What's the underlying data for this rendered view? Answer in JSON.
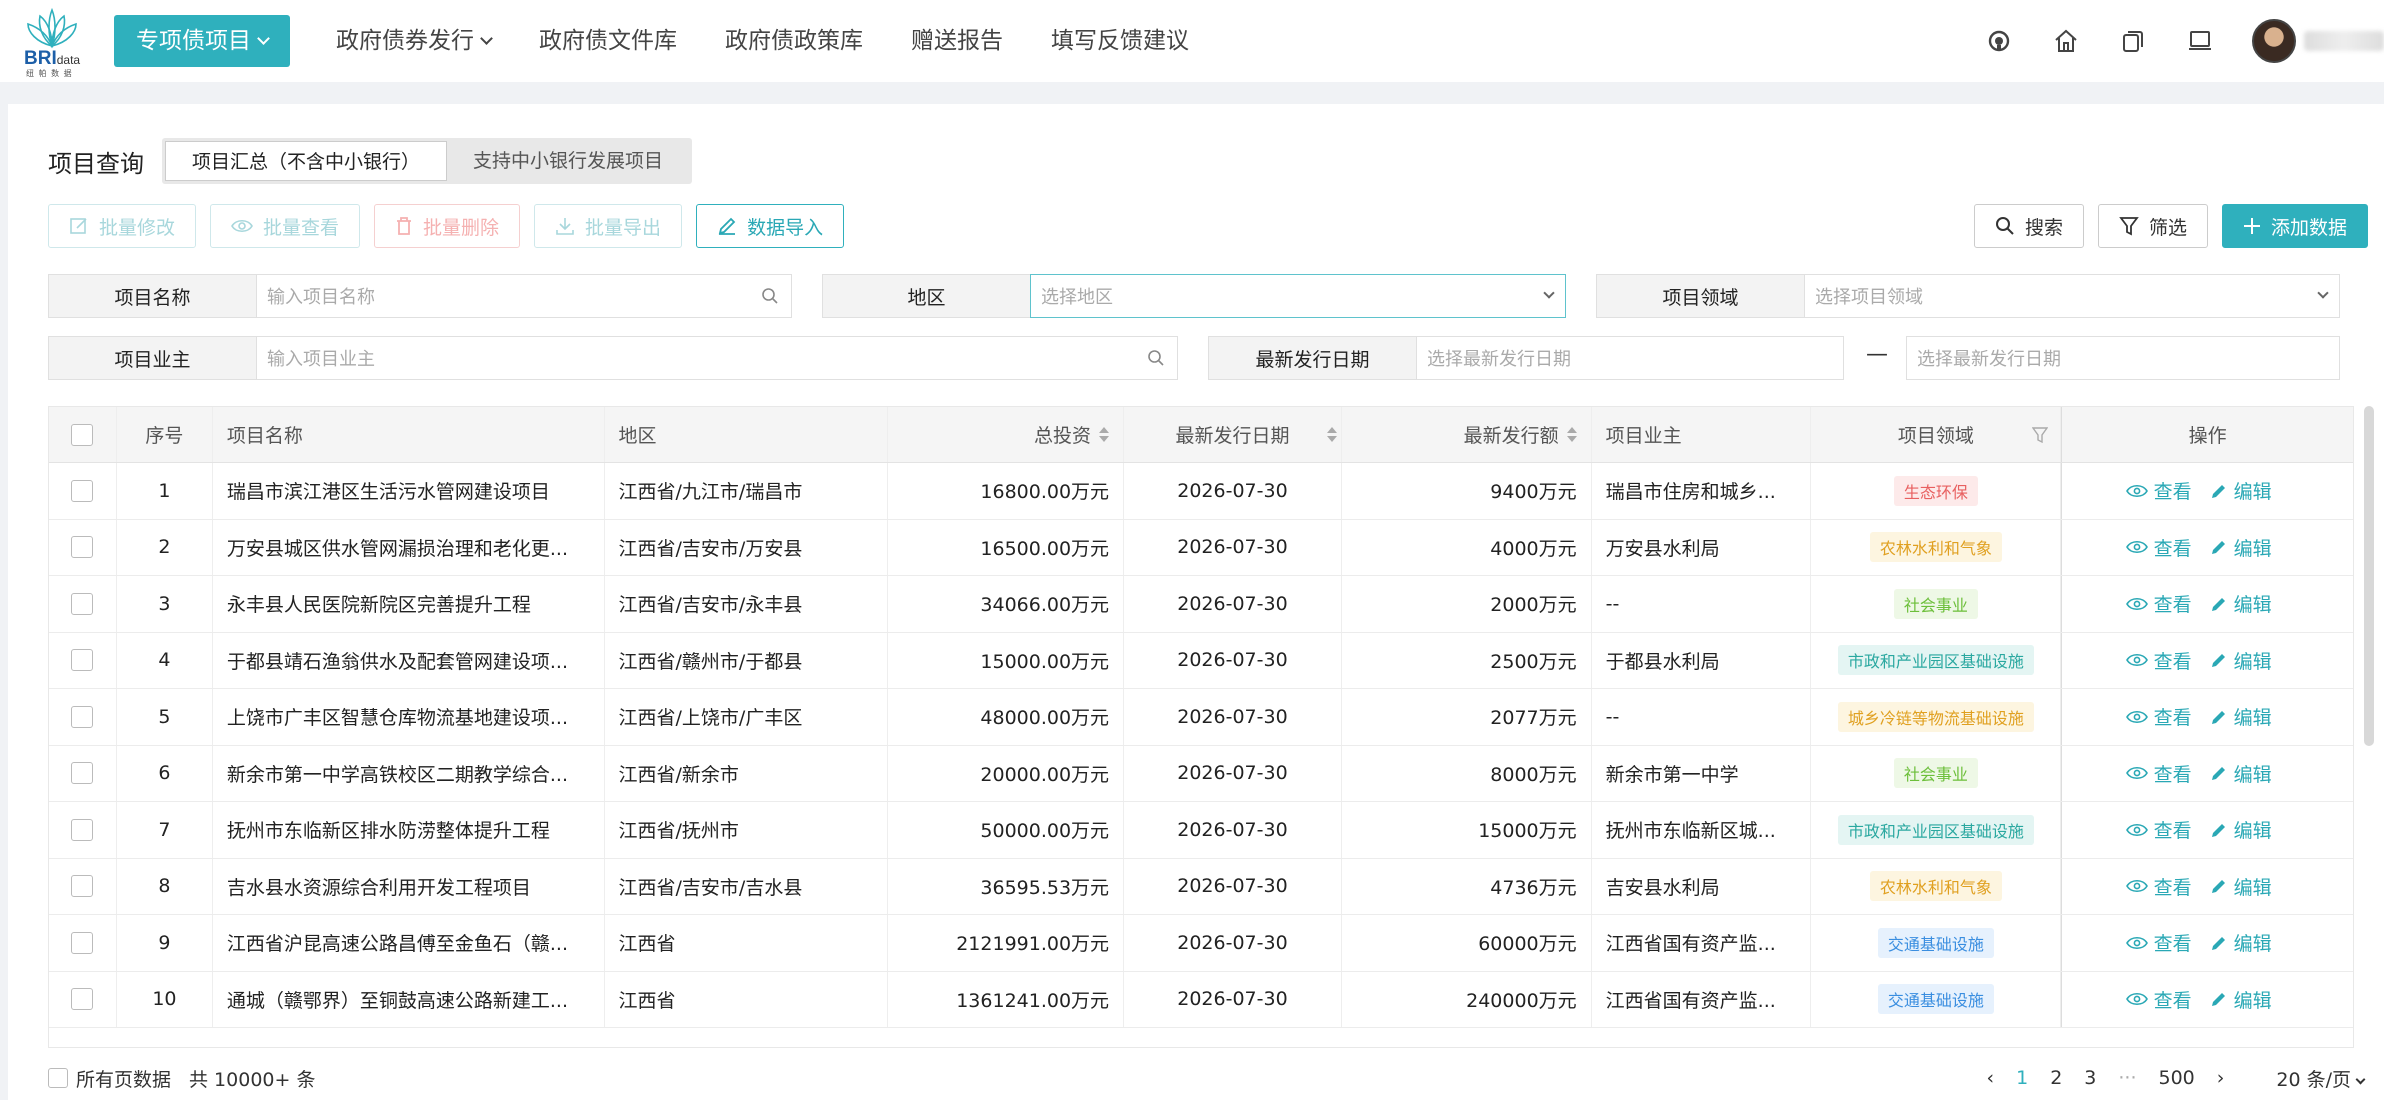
{
  "logo": {
    "brand": "BRI",
    "brand_small": "data",
    "sub": "纽 帕 数 据"
  },
  "nav": {
    "items": [
      {
        "label": "专项债项目",
        "active": true,
        "dropdown": true
      },
      {
        "label": "政府债券发行",
        "active": false,
        "dropdown": true
      },
      {
        "label": "政府债文件库",
        "active": false,
        "dropdown": false
      },
      {
        "label": "政府债政策库",
        "active": false,
        "dropdown": false
      },
      {
        "label": "赠送报告",
        "active": false,
        "dropdown": false
      },
      {
        "label": "填写反馈建议",
        "active": false,
        "dropdown": false
      }
    ],
    "right_icons": [
      "headset-icon",
      "home-icon",
      "copy-icon",
      "monitor-icon"
    ]
  },
  "page": {
    "title": "项目查询",
    "tabs": [
      {
        "label": "项目汇总（不含中小银行）",
        "active": true
      },
      {
        "label": "支持中小银行发展项目",
        "active": false
      }
    ]
  },
  "toolbar": {
    "batch_edit": "批量修改",
    "batch_view": "批量查看",
    "batch_delete": "批量删除",
    "batch_export": "批量导出",
    "data_import": "数据导入",
    "search": "搜索",
    "filter": "筛选",
    "add": "添加数据"
  },
  "filters": {
    "name": {
      "label": "项目名称",
      "placeholder": "输入项目名称"
    },
    "area": {
      "label": "地区",
      "placeholder": "选择地区"
    },
    "field": {
      "label": "项目领域",
      "placeholder": "选择项目领域"
    },
    "owner": {
      "label": "项目业主",
      "placeholder": "输入项目业主"
    },
    "date": {
      "label": "最新发行日期",
      "placeholder_start": "选择最新发行日期",
      "placeholder_end": "选择最新发行日期",
      "separator": "—"
    }
  },
  "table": {
    "headers": {
      "no": "序号",
      "name": "项目名称",
      "area": "地区",
      "investment": "总投资",
      "date": "最新发行日期",
      "amount": "最新发行额",
      "owner": "项目业主",
      "field": "项目领域",
      "op": "操作"
    },
    "view_label": "查看",
    "edit_label": "编辑",
    "rows": [
      {
        "no": "1",
        "name": "瑞昌市滨江港区生活污水管网建设项目",
        "area": "江西省/九江市/瑞昌市",
        "investment": "16800.00万元",
        "date": "2026-07-30",
        "amount": "9400万元",
        "owner": "瑞昌市住房和城乡...",
        "field": "生态环保",
        "field_color": "#e86060",
        "field_bg": "#fdeaea"
      },
      {
        "no": "2",
        "name": "万安县城区供水管网漏损治理和老化更...",
        "area": "江西省/吉安市/万安县",
        "investment": "16500.00万元",
        "date": "2026-07-30",
        "amount": "4000万元",
        "owner": "万安县水利局",
        "field": "农林水利和气象",
        "field_color": "#e0a020",
        "field_bg": "#fdf5e0"
      },
      {
        "no": "3",
        "name": "永丰县人民医院新院区完善提升工程",
        "area": "江西省/吉安市/永丰县",
        "investment": "34066.00万元",
        "date": "2026-07-30",
        "amount": "2000万元",
        "owner": "--",
        "field": "社会事业",
        "field_color": "#6cbf3a",
        "field_bg": "#eef8e6"
      },
      {
        "no": "4",
        "name": "于都县靖石渔翁供水及配套管网建设项...",
        "area": "江西省/赣州市/于都县",
        "investment": "15000.00万元",
        "date": "2026-07-30",
        "amount": "2500万元",
        "owner": "于都县水利局",
        "field": "市政和产业园区基础设施",
        "field_color": "#2aa8a0",
        "field_bg": "#e4f5f3"
      },
      {
        "no": "5",
        "name": "上饶市广丰区智慧仓库物流基地建设项...",
        "area": "江西省/上饶市/广丰区",
        "investment": "48000.00万元",
        "date": "2026-07-30",
        "amount": "2077万元",
        "owner": "--",
        "field": "城乡冷链等物流基础设施",
        "field_color": "#e0a020",
        "field_bg": "#fdf5e0"
      },
      {
        "no": "6",
        "name": "新余市第一中学高铁校区二期教学综合...",
        "area": "江西省/新余市",
        "investment": "20000.00万元",
        "date": "2026-07-30",
        "amount": "8000万元",
        "owner": "新余市第一中学",
        "field": "社会事业",
        "field_color": "#6cbf3a",
        "field_bg": "#eef8e6"
      },
      {
        "no": "7",
        "name": "抚州市东临新区排水防涝整体提升工程",
        "area": "江西省/抚州市",
        "investment": "50000.00万元",
        "date": "2026-07-30",
        "amount": "15000万元",
        "owner": "抚州市东临新区城...",
        "field": "市政和产业园区基础设施",
        "field_color": "#2aa8a0",
        "field_bg": "#e4f5f3"
      },
      {
        "no": "8",
        "name": "吉水县水资源综合利用开发工程项目",
        "area": "江西省/吉安市/吉水县",
        "investment": "36595.53万元",
        "date": "2026-07-30",
        "amount": "4736万元",
        "owner": "吉安县水利局",
        "field": "农林水利和气象",
        "field_color": "#e0a020",
        "field_bg": "#fdf5e0"
      },
      {
        "no": "9",
        "name": "江西省沪昆高速公路昌傅至金鱼石（赣...",
        "area": "江西省",
        "investment": "2121991.00万元",
        "date": "2026-07-30",
        "amount": "60000万元",
        "owner": "江西省国有资产监...",
        "field": "交通基础设施",
        "field_color": "#3a8ee0",
        "field_bg": "#e6f1fd"
      },
      {
        "no": "10",
        "name": "通城（赣鄂界）至铜鼓高速公路新建工...",
        "area": "江西省",
        "investment": "1361241.00万元",
        "date": "2026-07-30",
        "amount": "240000万元",
        "owner": "江西省国有资产监...",
        "field": "交通基础设施",
        "field_color": "#3a8ee0",
        "field_bg": "#e6f1fd"
      }
    ]
  },
  "footer": {
    "all_pages": "所有页数据",
    "total": "共 10000+ 条",
    "pages": [
      "1",
      "2",
      "3"
    ],
    "ellipsis": "···",
    "last_page": "500",
    "page_size": "20 条/页"
  },
  "colors": {
    "accent": "#2fb0bd"
  }
}
